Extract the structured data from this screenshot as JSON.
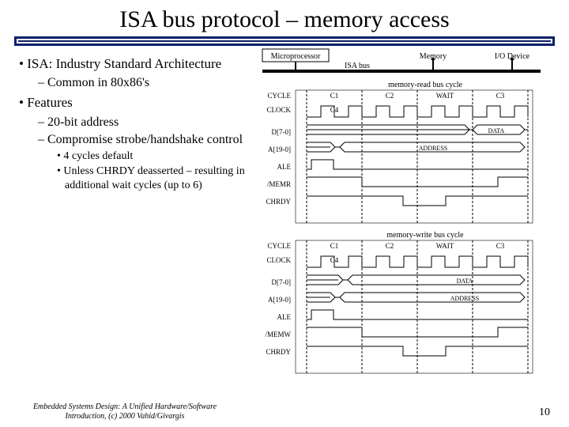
{
  "title": "ISA bus protocol – memory access",
  "bullets": {
    "b1a": "ISA: Industry Standard Architecture",
    "b2a": "Common in 80x86's",
    "b1b": "Features",
    "b2b": "20-bit address",
    "b2c": "Compromise strobe/handshake control",
    "b3a": "4 cycles default",
    "b3b": "Unless CHRDY deasserted – resulting in additional wait cycles (up to 6)"
  },
  "diagram": {
    "boxes": {
      "micro": "Microprocessor",
      "memory": "Memory",
      "io": "I/O Device"
    },
    "isa_bus": "ISA bus",
    "read_title": "memory-read bus cycle",
    "write_title": "memory-write bus cycle",
    "cycles": {
      "c1": "C1",
      "c2": "C2",
      "wait": "WAIT",
      "c3": "C3",
      "c4": "C4"
    },
    "signals": {
      "cycle": "CYCLE",
      "clock": "CLOCK",
      "data": "D[7-0]",
      "addr": "A[19-0]",
      "ale": "ALE",
      "memr": "/MEMR",
      "memw": "/MEMW",
      "chrdy": "CHRDY"
    },
    "data_label": "DATA",
    "addr_label": "ADDRESS"
  },
  "footer": "Embedded Systems Design: A Unified Hardware/Software Introduction, (c) 2000 Vahid/Givargis",
  "page": "10"
}
